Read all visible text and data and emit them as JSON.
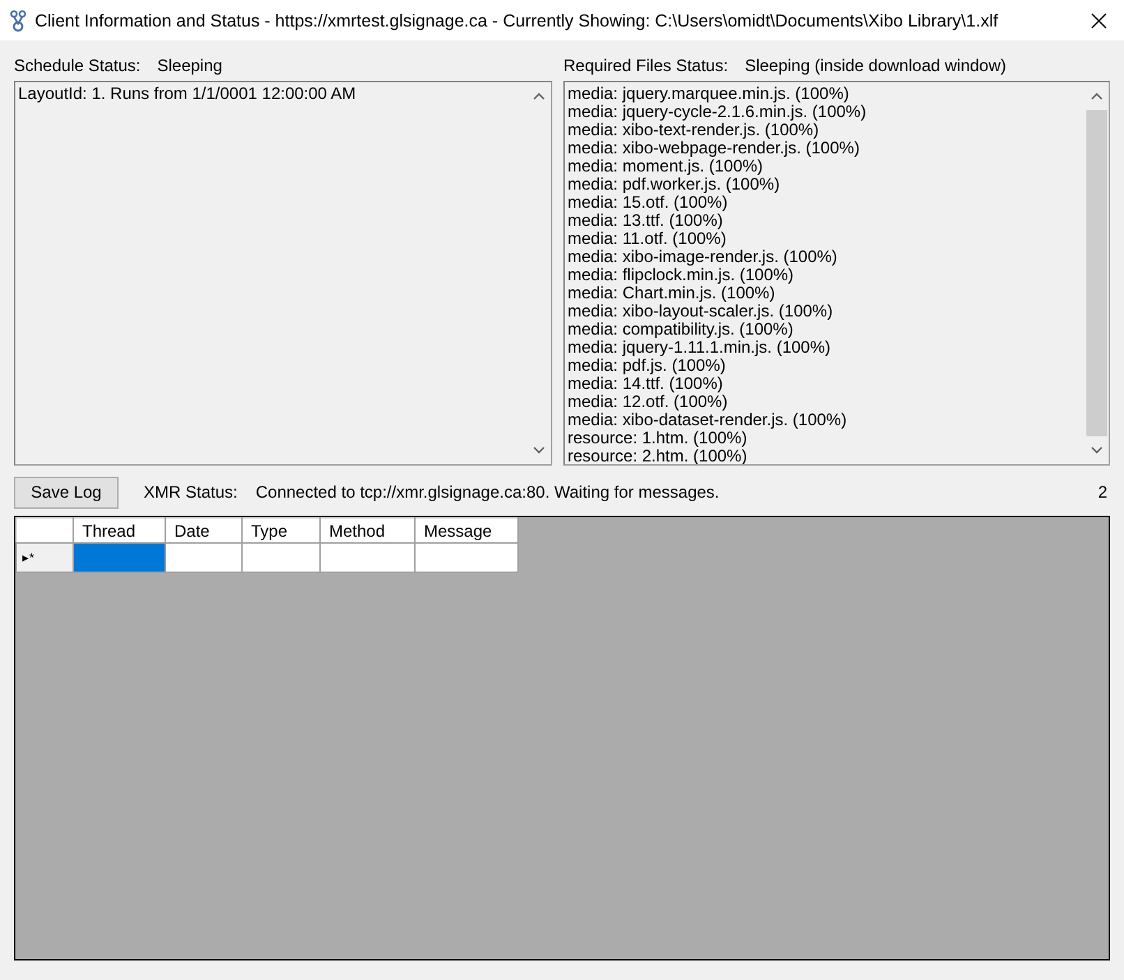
{
  "window": {
    "title": "Client Information and Status - https://xmrtest.glsignage.ca - Currently Showing: C:\\Users\\omidt\\Documents\\Xibo Library\\1.xlf"
  },
  "schedule": {
    "label": "Schedule Status:",
    "value": "Sleeping",
    "lines": [
      "LayoutId: 1. Runs from 1/1/0001 12:00:00 AM"
    ]
  },
  "required_files": {
    "label": "Required Files Status:",
    "value": "Sleeping (inside download window)",
    "lines": [
      "media: jquery.marquee.min.js. (100%)",
      "media: jquery-cycle-2.1.6.min.js. (100%)",
      "media: xibo-text-render.js. (100%)",
      "media: xibo-webpage-render.js. (100%)",
      "media: moment.js. (100%)",
      "media: pdf.worker.js. (100%)",
      "media: 15.otf. (100%)",
      "media: 13.ttf. (100%)",
      "media: 11.otf. (100%)",
      "media: xibo-image-render.js. (100%)",
      "media: flipclock.min.js. (100%)",
      "media: Chart.min.js. (100%)",
      "media: xibo-layout-scaler.js. (100%)",
      "media: compatibility.js. (100%)",
      "media: jquery-1.11.1.min.js. (100%)",
      "media: pdf.js. (100%)",
      "media: 14.ttf. (100%)",
      "media: 12.otf. (100%)",
      "media: xibo-dataset-render.js. (100%)",
      "resource: 1.htm. (100%)",
      "resource: 2.htm. (100%)"
    ]
  },
  "save_button": "Save Log",
  "xmr": {
    "label": "XMR Status:",
    "value": "Connected to tcp://xmr.glsignage.ca:80. Waiting for messages.",
    "count": "2"
  },
  "table": {
    "columns": [
      "Thread",
      "Date",
      "Type",
      "Method",
      "Message"
    ],
    "rows": [
      {
        "marker": "▸*",
        "cells": [
          {
            "selected": true
          },
          {
            "selected": false
          },
          {
            "selected": false
          },
          {
            "selected": false
          },
          {
            "selected": false
          }
        ]
      }
    ]
  }
}
